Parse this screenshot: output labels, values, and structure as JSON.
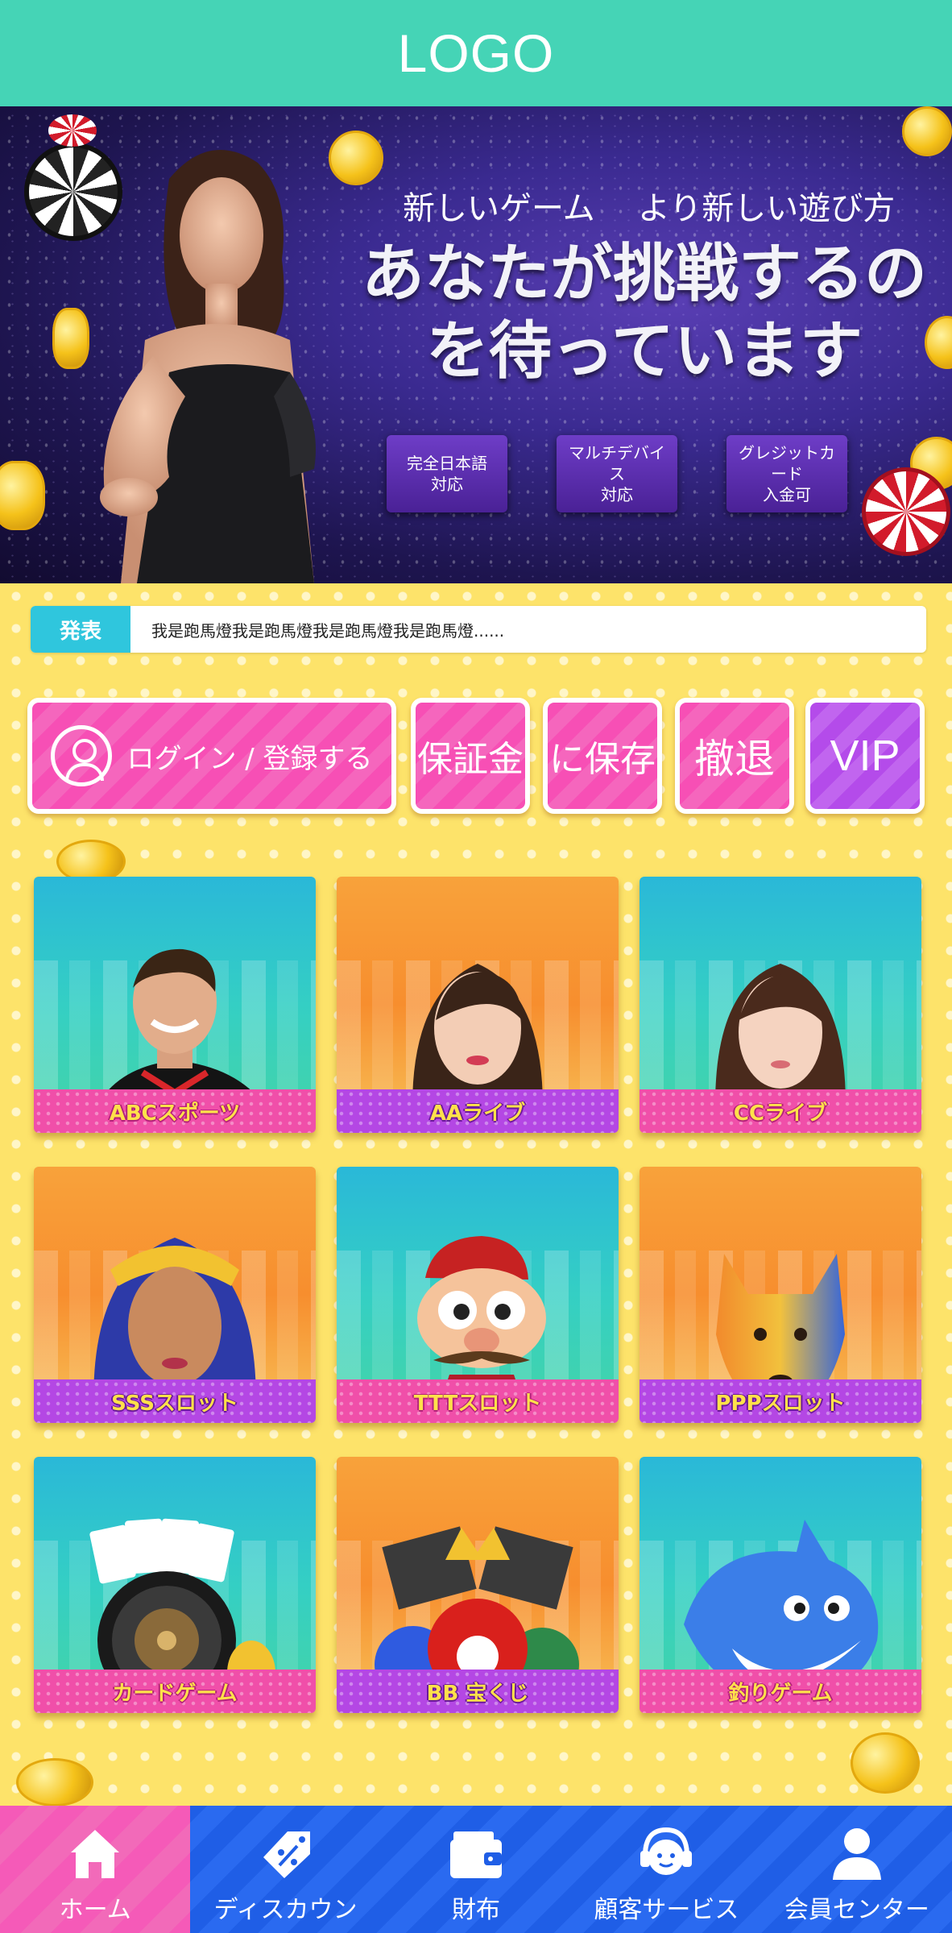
{
  "header": {
    "logo": "LOGO"
  },
  "banner": {
    "subtitle_left": "新しいゲーム",
    "subtitle_right": "より新しい遊び方",
    "title_line1": "あなたが挑戦するの",
    "title_line2": "を待っています",
    "features": [
      {
        "line1": "完全日本語",
        "line2": "対応"
      },
      {
        "line1": "マルチデバイス",
        "line2": "対応"
      },
      {
        "line1": "グレジットカード",
        "line2": "入金可"
      }
    ]
  },
  "announcement": {
    "label": "発表",
    "text": "我是跑馬燈我是跑馬燈我是跑馬燈我是跑馬燈......"
  },
  "actions": {
    "login": "ログイン / 登録する",
    "deposit": "保証金",
    "save": "に保存",
    "withdraw": "撤退",
    "vip": "VIP"
  },
  "games": [
    {
      "label": "ABCスポーツ"
    },
    {
      "label": "AAライブ"
    },
    {
      "label": "CCライブ"
    },
    {
      "label": "SSSスロット"
    },
    {
      "label": "TTTスロット"
    },
    {
      "label": "PPPスロット"
    },
    {
      "label": "カードゲーム"
    },
    {
      "label": "BB 宝くじ"
    },
    {
      "label": "釣りゲーム"
    }
  ],
  "nav": [
    {
      "label": "ホーム",
      "icon": "home-icon",
      "active": true
    },
    {
      "label": "ディスカウン",
      "icon": "discount-tag-icon",
      "active": false
    },
    {
      "label": "財布",
      "icon": "wallet-icon",
      "active": false
    },
    {
      "label": "顧客サービス",
      "icon": "customer-service-icon",
      "active": false
    },
    {
      "label": "会員センター",
      "icon": "member-icon",
      "active": false
    }
  ],
  "colors": {
    "header": "#45d4b6",
    "background": "#fde36a",
    "action_pink": "#f74fb5",
    "action_purple": "#b44bea",
    "nav_blue": "#1f5ee6",
    "nav_active": "#f55ab8",
    "announce_label": "#2fc6dd"
  }
}
